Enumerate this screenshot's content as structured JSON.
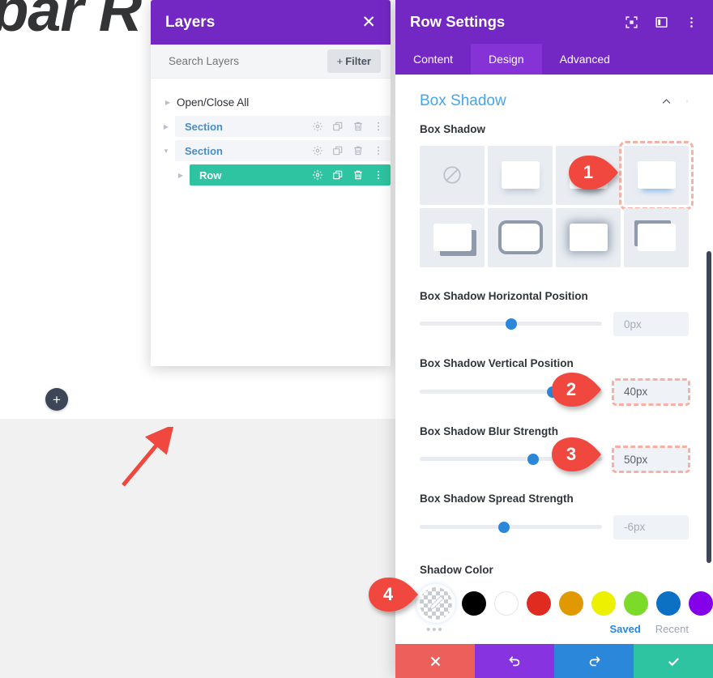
{
  "canvas": {
    "heading_partial": "bar R",
    "add_button_label": "+"
  },
  "layers_panel": {
    "title": "Layers",
    "close_icon": "close-icon",
    "search_placeholder": "Search Layers",
    "search_value": "",
    "filter_label": "Filter",
    "filter_plus": "+",
    "open_close_all": "Open/Close All",
    "row_icons": [
      "gear-icon",
      "duplicate-icon",
      "trash-icon",
      "kebab-icon"
    ],
    "items": [
      {
        "label": "Section",
        "type": "section",
        "expanded": false,
        "selected": false,
        "indent": 1
      },
      {
        "label": "Section",
        "type": "section",
        "expanded": true,
        "selected": false,
        "indent": 1
      },
      {
        "label": "Row",
        "type": "row",
        "expanded": false,
        "selected": true,
        "indent": 2
      }
    ]
  },
  "settings": {
    "title": "Row Settings",
    "header_icons": [
      "fullscreen-icon",
      "layout-panel-icon",
      "kebab-icon"
    ],
    "tabs": [
      {
        "label": "Content",
        "active": false
      },
      {
        "label": "Design",
        "active": true
      },
      {
        "label": "Advanced",
        "active": false
      }
    ],
    "section": {
      "title": "Box Shadow",
      "collapse_icon": "chevron-up-icon",
      "kebab_icon": "kebab-icon"
    },
    "box_shadow": {
      "label": "Box Shadow",
      "presets": [
        {
          "name": "none",
          "selected": false
        },
        {
          "name": "preset-soft-bottom",
          "selected": false
        },
        {
          "name": "preset-drop-down",
          "selected": false
        },
        {
          "name": "preset-blue-underline",
          "selected": true
        },
        {
          "name": "preset-hard-corner",
          "selected": false
        },
        {
          "name": "preset-outline-all",
          "selected": false
        },
        {
          "name": "preset-inner-glow",
          "selected": false
        },
        {
          "name": "preset-top-left-edge",
          "selected": false
        }
      ]
    },
    "sliders": [
      {
        "label": "Box Shadow Horizontal Position",
        "value": "0px",
        "thumb_percent": 50,
        "highlighted": false
      },
      {
        "label": "Box Shadow Vertical Position",
        "value": "40px",
        "thumb_percent": 73,
        "highlighted": true
      },
      {
        "label": "Box Shadow Blur Strength",
        "value": "50px",
        "thumb_percent": 62,
        "highlighted": true
      },
      {
        "label": "Box Shadow Spread Strength",
        "value": "-6px",
        "thumb_percent": 46,
        "highlighted": false
      }
    ],
    "shadow_color": {
      "label": "Shadow Color",
      "current_swatch": "transparent-eyedropper",
      "more_ellipsis": "•••",
      "swatches": [
        {
          "name": "black",
          "hex": "#000000"
        },
        {
          "name": "white",
          "hex": "#FFFFFF"
        },
        {
          "name": "red",
          "hex": "#E02B20"
        },
        {
          "name": "orange",
          "hex": "#E09900"
        },
        {
          "name": "yellow",
          "hex": "#EDF000"
        },
        {
          "name": "green",
          "hex": "#7CDB2A"
        },
        {
          "name": "blue",
          "hex": "#0C71C3"
        },
        {
          "name": "purple",
          "hex": "#8300E9"
        },
        {
          "name": "transparent",
          "hex": "transparent"
        }
      ],
      "saved_label": "Saved",
      "recent_label": "Recent"
    },
    "actions": [
      {
        "name": "cancel-button",
        "icon": "close-icon",
        "color": "#EC5F5B"
      },
      {
        "name": "undo-button",
        "icon": "undo-icon",
        "color": "#8733E0"
      },
      {
        "name": "redo-button",
        "icon": "redo-icon",
        "color": "#2B87DA"
      },
      {
        "name": "save-button",
        "icon": "check-icon",
        "color": "#2EC4A1"
      }
    ]
  },
  "callouts": [
    {
      "number": "1",
      "target": "box-shadow-preset-4"
    },
    {
      "number": "2",
      "target": "vertical-position-value"
    },
    {
      "number": "3",
      "target": "blur-strength-value"
    },
    {
      "number": "4",
      "target": "shadow-color-current-swatch"
    }
  ]
}
